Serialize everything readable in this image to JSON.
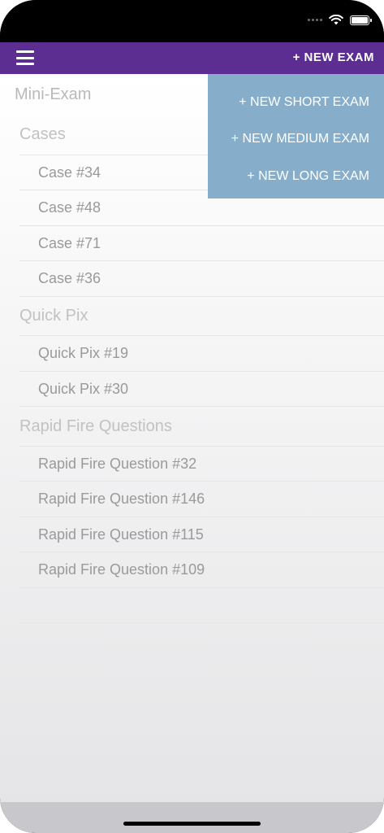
{
  "navbar": {
    "new_exam_label": "+ NEW EXAM",
    "color": "#5c2e91"
  },
  "dropdown": {
    "color": "#86aecb",
    "items": [
      {
        "label": "+ NEW SHORT EXAM"
      },
      {
        "label": "+ NEW MEDIUM EXAM"
      },
      {
        "label": "+ NEW LONG EXAM"
      }
    ]
  },
  "exam": {
    "title": "Mini-Exam",
    "sections": [
      {
        "header": "Cases",
        "items": [
          "Case #34",
          "Case #48",
          "Case #71",
          "Case #36"
        ]
      },
      {
        "header": "Quick Pix",
        "items": [
          "Quick Pix #19",
          "Quick Pix #30"
        ]
      },
      {
        "header": "Rapid Fire Questions",
        "items": [
          "Rapid Fire Question #32",
          "Rapid Fire Question #146",
          "Rapid Fire Question #115",
          "Rapid Fire Question #109"
        ]
      }
    ]
  },
  "icons": {
    "menu": "hamburger-menu-icon",
    "wifi": "wifi-icon",
    "battery": "battery-icon",
    "signal": "cellular-signal-icon"
  }
}
